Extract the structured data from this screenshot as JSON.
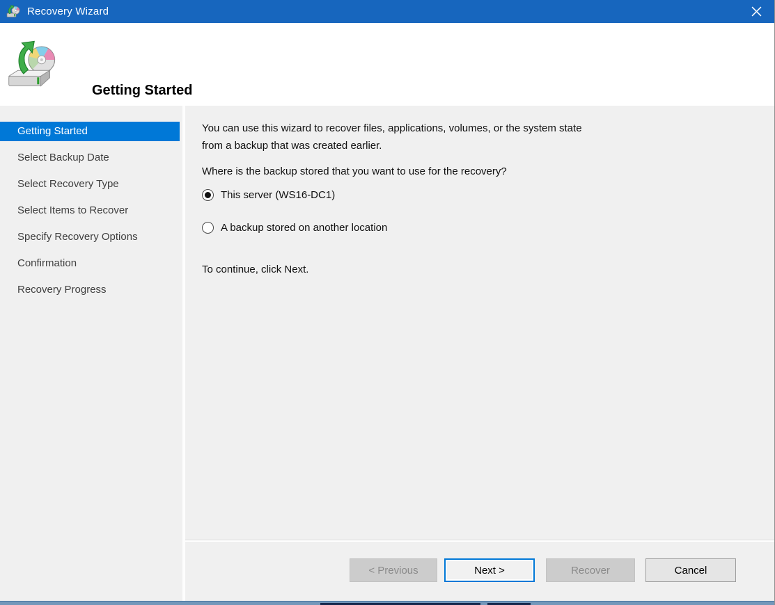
{
  "colors": {
    "titlebar": "#1766be",
    "accent": "#0078d7",
    "body_bg": "#f0f0f0",
    "header_bg": "#ffffff",
    "disabled_bg": "#cccccc",
    "disabled_text": "#8a8a8a",
    "button_bg": "#e5e5e5",
    "button_border": "#9d9d9d",
    "sidebar_text": "#3f3f3f"
  },
  "titlebar": {
    "title": "Recovery Wizard",
    "icons": {
      "app": "backup-recovery-drive",
      "close": "✕"
    }
  },
  "header": {
    "title": "Getting Started",
    "icon": "drive-with-disc-and-green-up-arrow"
  },
  "sidebar": {
    "items": [
      {
        "label": "Getting Started",
        "active": true
      },
      {
        "label": "Select Backup Date",
        "active": false
      },
      {
        "label": "Select Recovery Type",
        "active": false
      },
      {
        "label": "Select Items to Recover",
        "active": false
      },
      {
        "label": "Specify Recovery Options",
        "active": false
      },
      {
        "label": "Confirmation",
        "active": false
      },
      {
        "label": "Recovery Progress",
        "active": false
      }
    ]
  },
  "content": {
    "intro_lines": [
      "You can use this wizard to recover files, applications, volumes, or the system state",
      "from a backup that was created earlier."
    ],
    "question": "Where is the backup stored that you want to use for the recovery?",
    "options": [
      {
        "label": "This server (WS16-DC1)",
        "selected": true
      },
      {
        "label": "A backup stored on another location",
        "selected": false
      }
    ],
    "instruction": "To continue, click Next."
  },
  "footer": {
    "buttons": [
      {
        "label": "< Previous",
        "enabled": false,
        "focused": false
      },
      {
        "label": "Next >",
        "enabled": true,
        "focused": true
      },
      {
        "label": "Recover",
        "enabled": false,
        "focused": false
      },
      {
        "label": "Cancel",
        "enabled": true,
        "focused": false
      }
    ]
  }
}
